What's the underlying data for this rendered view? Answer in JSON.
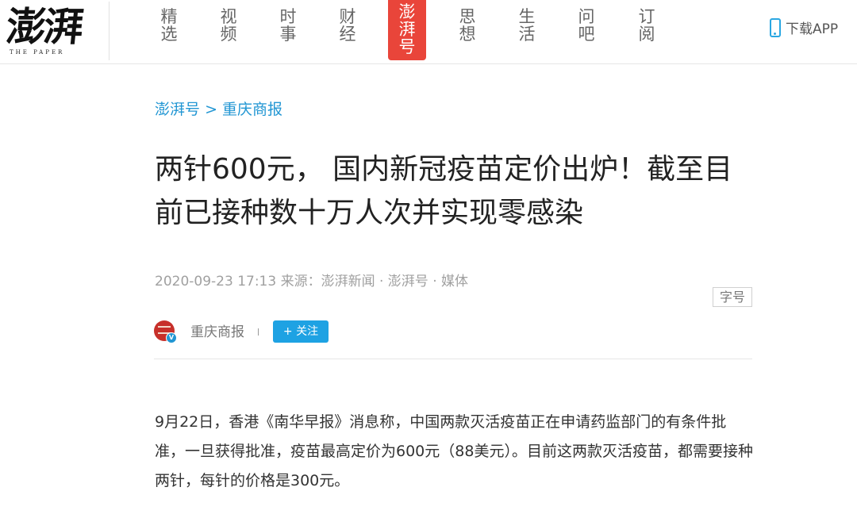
{
  "header": {
    "logo_cn": "澎湃",
    "logo_en": "THE PAPER",
    "nav": [
      {
        "label": "精选",
        "active": false
      },
      {
        "label": "视频",
        "active": false
      },
      {
        "label": "时事",
        "active": false
      },
      {
        "label": "财经",
        "active": false
      },
      {
        "label": "澎湃号",
        "active": true
      },
      {
        "label": "思想",
        "active": false
      },
      {
        "label": "生活",
        "active": false
      },
      {
        "label": "问吧",
        "active": false
      },
      {
        "label": "订阅",
        "active": false
      }
    ],
    "download_label": "下载APP",
    "download_icon": "phone-icon",
    "accent_color": "#e9453a",
    "link_color": "#2196d3"
  },
  "breadcrumb": {
    "root": "澎湃号",
    "separator": ">",
    "current": "重庆商报"
  },
  "article": {
    "title": "两针600元， 国内新冠疫苗定价出炉！截至目前已接种数十万人次并实现零感染",
    "meta": "2020-09-23 17:13 来源：澎湃新闻 · 澎湃号 · 媒体",
    "font_size_button": "字号",
    "author": {
      "name": "重庆商报",
      "follow_label": "+ 关注",
      "verified_mark": "V"
    },
    "body": "9月22日，香港《南华早报》消息称，中国两款灭活疫苗正在申请药监部门的有条件批准，一旦获得批准，疫苗最高定价为600元（88美元）。目前这两款灭活疫苗，都需要接种两针，每针的价格是300元。"
  }
}
